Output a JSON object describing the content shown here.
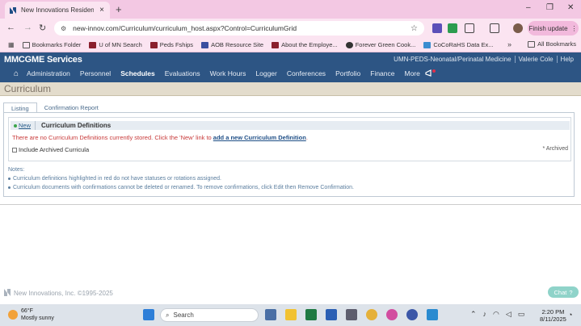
{
  "browser": {
    "tab_title": "New Innovations Residency Ma",
    "tab_close": "×",
    "new_tab": "+",
    "url": "new-innov.com/Curriculum/curriculum_host.aspx?Control=CurriculumGrid",
    "finish_update": "Finish update",
    "minimize": "–",
    "restore": "❐",
    "close": "✕"
  },
  "bookmarks": {
    "items": [
      "Bookmarks Folder",
      "U of MN Search",
      "Peds Fships",
      "AOB Resource Site",
      "About the Employe...",
      "Forever Green Cook...",
      "CoCoRaHS Data Ex..."
    ],
    "all": "All Bookmarks",
    "more": "»"
  },
  "app": {
    "name": "MMCGME Services",
    "toplinks": [
      "UMN-PEDS-Neonatal/Perinatal Medicine",
      "Valerie Cole",
      "Help"
    ],
    "nav": [
      "Administration",
      "Personnel",
      "Schedules",
      "Evaluations",
      "Work Hours",
      "Logger",
      "Conferences",
      "Portfolio",
      "Finance",
      "More"
    ],
    "active_nav": "Schedules"
  },
  "page": {
    "title": "Curriculum",
    "tabs": [
      "Listing",
      "Confirmation Report"
    ],
    "new_label": "New",
    "section_title": "Curriculum Definitions",
    "empty_prefix": "There are no Curriculum Definitions currently stored. Click the 'New' link to ",
    "empty_link": "add a new Curriculum Definition",
    "empty_suffix": ".",
    "include_archived": "Include Archived Curricula",
    "archived_note": "* Archived",
    "notes_label": "Notes:",
    "notes": [
      "Curriculum definitions highlighted in red do not have statuses or rotations assigned.",
      "Curriculum documents with confirmations cannot be deleted or renamed. To remove confirmations, click Edit then Remove Confirmation."
    ]
  },
  "footer": {
    "copyright": "New Innovations, Inc. ©1995-2025",
    "chat": "Chat"
  },
  "taskbar": {
    "temp": "66°F",
    "weather": "Mostly sunny",
    "search": "Search",
    "time": "2:20 PM",
    "date": "8/11/2025"
  },
  "colors": {
    "header_bg": "#2d5584",
    "tabstrip_bg": "#f3c8e3",
    "title_bg": "#e3dccc",
    "error_text": "#c83a3a"
  }
}
